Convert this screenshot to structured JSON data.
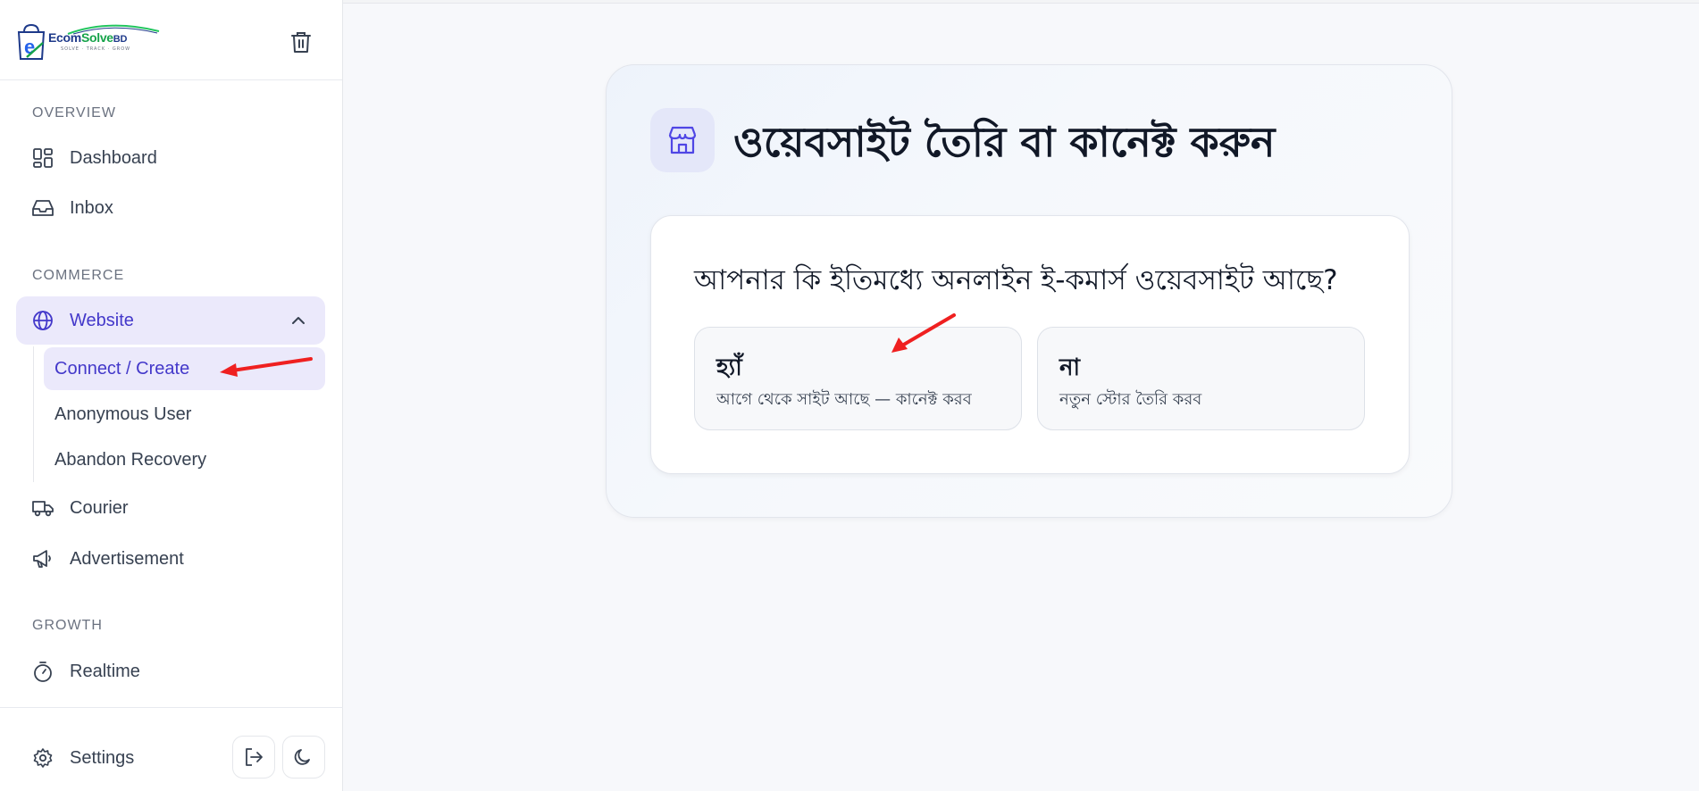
{
  "sidebar": {
    "brand": {
      "name_main": "Ecom",
      "name_accent": "Solve",
      "name_suffix": "BD",
      "tagline": "SOLVE · TRACK · GROW"
    },
    "sections": {
      "overview": "OVERVIEW",
      "commerce": "COMMERCE",
      "growth": "GROWTH"
    },
    "items": {
      "dashboard": "Dashboard",
      "inbox": "Inbox",
      "website": "Website",
      "courier": "Courier",
      "advertisement": "Advertisement",
      "realtime": "Realtime",
      "settings": "Settings"
    },
    "website_sub": {
      "connect": "Connect / Create",
      "anonymous": "Anonymous User",
      "abandon": "Abandon Recovery"
    }
  },
  "main": {
    "title": "ওয়েবসাইট তৈরি বা কানেক্ট করুন",
    "question": "আপনার কি ইতিমধ্যে অনলাইন ই-কমার্স ওয়েবসাইট আছে?",
    "options": [
      {
        "title": "হ্যাঁ",
        "subtitle": "আগে থেকে সাইট আছে — কানেক্ট করব"
      },
      {
        "title": "না",
        "subtitle": "নতুন স্টোর তৈরি করব"
      }
    ]
  },
  "colors": {
    "accent": "#4338ca",
    "active_bg": "#ebe9fb",
    "annotation_arrow": "#ef2020"
  }
}
